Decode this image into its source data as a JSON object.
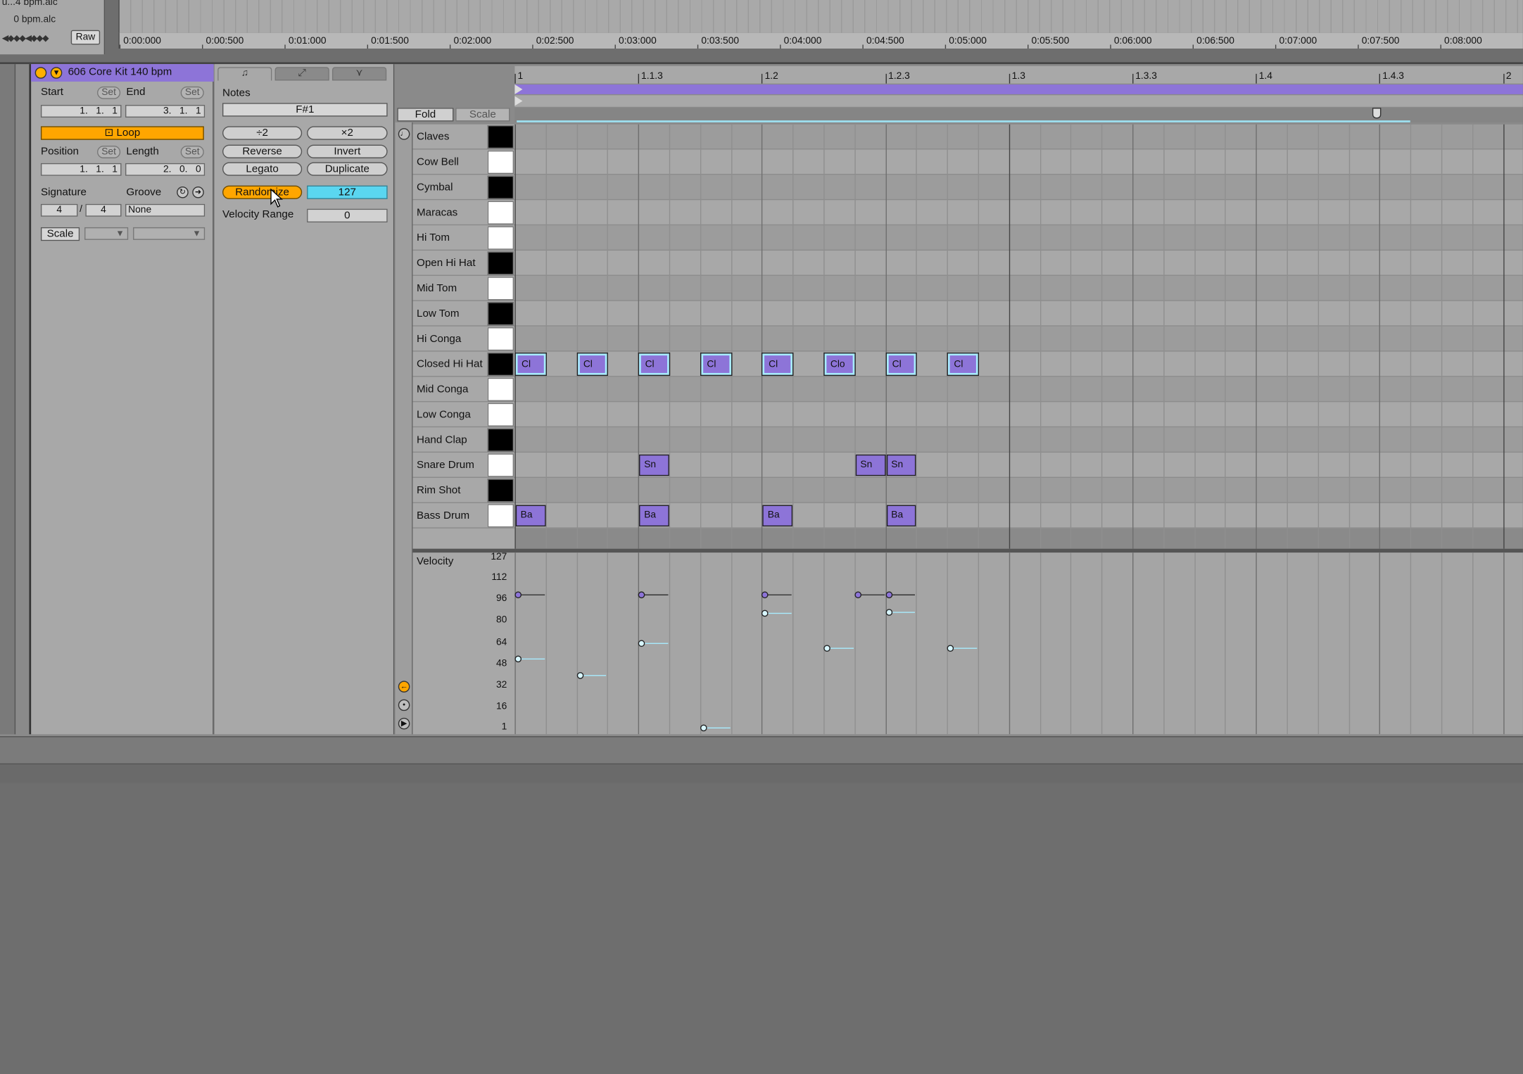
{
  "top": {
    "files": [
      "u...4 bpm.alc",
      "0 bpm.alc"
    ],
    "raw_label": "Raw",
    "warp_marks": "◀◆◆◆◀◆◆◆",
    "times": [
      "0:00:000",
      "0:00:500",
      "0:01:000",
      "0:01:500",
      "0:02:000",
      "0:02:500",
      "0:03:000",
      "0:03:500",
      "0:04:000",
      "0:04:500",
      "0:05:000",
      "0:05:500",
      "0:06:000",
      "0:06:500",
      "0:07:000",
      "0:07:500",
      "0:08:000"
    ]
  },
  "clip": {
    "name": "606 Core Kit 140 bpm",
    "start_label": "Start",
    "end_label": "End",
    "set_label": "Set",
    "start_value": "1.   1.   1",
    "end_value": "3.   1.   1",
    "loop_label": "Loop",
    "position_label": "Position",
    "length_label": "Length",
    "position_value": "1.   1.   1",
    "length_value": "2.   0.   0",
    "signature_label": "Signature",
    "groove_label": "Groove",
    "sig_num": "4",
    "sig_den": "4",
    "sig_sep": "/",
    "groove_value": "None",
    "scale_label": "Scale"
  },
  "notes_panel": {
    "title": "Notes",
    "note_value": "F#1",
    "div2": "÷2",
    "mul2": "×2",
    "reverse": "Reverse",
    "invert": "Invert",
    "legato": "Legato",
    "duplicate": "Duplicate",
    "randomize": "Randomize",
    "randomize_value": "127",
    "velocity_range_label": "Velocity Range",
    "velocity_range_value": "0"
  },
  "piano_roll": {
    "fold_label": "Fold",
    "scale_label": "Scale",
    "beat_labels": [
      "1",
      "1.1.3",
      "1.2",
      "1.2.3",
      "1.3",
      "1.3.3",
      "1.4",
      "1.4.3",
      "2"
    ],
    "keys": [
      {
        "name": "Claves",
        "black": true
      },
      {
        "name": "Cow Bell",
        "black": false
      },
      {
        "name": "Cymbal",
        "black": true
      },
      {
        "name": "Maracas",
        "black": false
      },
      {
        "name": "Hi Tom",
        "black": false
      },
      {
        "name": "Open Hi Hat",
        "black": true
      },
      {
        "name": "Mid Tom",
        "black": false
      },
      {
        "name": "Low Tom",
        "black": true
      },
      {
        "name": "Hi Conga",
        "black": false
      },
      {
        "name": "Closed Hi Hat",
        "black": true
      },
      {
        "name": "Mid Conga",
        "black": false
      },
      {
        "name": "Low Conga",
        "black": false
      },
      {
        "name": "Hand Clap",
        "black": true
      },
      {
        "name": "Snare Drum",
        "black": false
      },
      {
        "name": "Rim Shot",
        "black": true
      },
      {
        "name": "Bass Drum",
        "black": false
      }
    ],
    "notes": [
      {
        "row": 9,
        "step": 0,
        "label": "Cl",
        "selected": true,
        "velocity": 52
      },
      {
        "row": 9,
        "step": 2,
        "label": "Cl",
        "selected": true,
        "velocity": 40
      },
      {
        "row": 9,
        "step": 4,
        "label": "Cl",
        "selected": true,
        "velocity": 64
      },
      {
        "row": 9,
        "step": 6,
        "label": "Cl",
        "selected": true,
        "velocity": 1
      },
      {
        "row": 9,
        "step": 8,
        "label": "Cl",
        "selected": true,
        "velocity": 86
      },
      {
        "row": 9,
        "step": 10,
        "label": "Clo",
        "selected": true,
        "velocity": 60
      },
      {
        "row": 9,
        "step": 12,
        "label": "Cl",
        "selected": true,
        "velocity": 87
      },
      {
        "row": 9,
        "step": 14,
        "label": "Cl",
        "selected": true,
        "velocity": 60
      },
      {
        "row": 13,
        "step": 4,
        "label": "Sn",
        "selected": false,
        "velocity": 100
      },
      {
        "row": 13,
        "step": 11,
        "label": "Sn",
        "selected": false,
        "velocity": 100
      },
      {
        "row": 13,
        "step": 12,
        "label": "Sn",
        "selected": false,
        "velocity": 100
      },
      {
        "row": 15,
        "step": 0,
        "label": "Ba",
        "selected": false,
        "velocity": 100
      },
      {
        "row": 15,
        "step": 4,
        "label": "Ba",
        "selected": false,
        "velocity": 100
      },
      {
        "row": 15,
        "step": 8,
        "label": "Ba",
        "selected": false,
        "velocity": 100
      },
      {
        "row": 15,
        "step": 12,
        "label": "Ba",
        "selected": false,
        "velocity": 100
      }
    ]
  },
  "velocity": {
    "title": "Velocity",
    "ticks": [
      "127",
      "112",
      "96",
      "80",
      "64",
      "48",
      "32",
      "16",
      "1"
    ]
  },
  "colors": {
    "clip": "#8d74d8",
    "accent": "#ffa600",
    "selected": "#a8ecff",
    "randomize_value_bg": "#5ad6f0"
  }
}
